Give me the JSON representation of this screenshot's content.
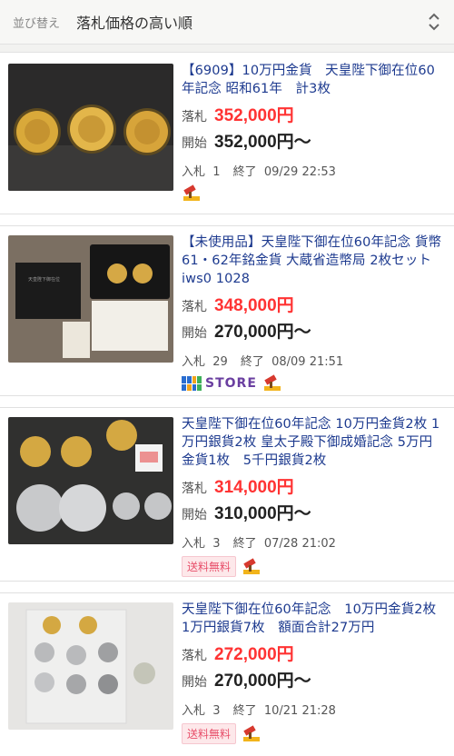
{
  "sortbar": {
    "label": "並び替え",
    "value": "落札価格の高い順"
  },
  "labels": {
    "sold": "落札",
    "start": "開始",
    "bids": "入札",
    "ends": "終了"
  },
  "items": [
    {
      "title": "【6909】10万円金貨　天皇陛下御在位60年記念 昭和61年　計3枚",
      "sold_price": "352,000円",
      "start_price": "352,000円～",
      "bids": "1",
      "end_time": "09/29 22:53",
      "badges": []
    },
    {
      "title": "【未使用品】天皇陛下御在位60年記念 貨幣 61・62年銘金貨 大蔵省造幣局 2枚セット iws0 1028",
      "sold_price": "348,000円",
      "start_price": "270,000円～",
      "bids": "29",
      "end_time": "08/09 21:51",
      "badges": [
        "STORE"
      ]
    },
    {
      "title": "天皇陛下御在位60年記念 10万円金貨2枚 1万円銀貨2枚 皇太子殿下御成婚記念 5万円金貨1枚　5千円銀貨2枚",
      "sold_price": "314,000円",
      "start_price": "310,000円～",
      "bids": "3",
      "end_time": "07/28 21:02",
      "badges": [
        "送料無料"
      ]
    },
    {
      "title": "天皇陛下御在位60年記念　10万円金貨2枚 1万円銀貨7枚　額面合計27万円",
      "sold_price": "272,000円",
      "start_price": "270,000円～",
      "bids": "3",
      "end_time": "10/21 21:28",
      "badges": [
        "送料無料"
      ]
    }
  ],
  "colors": {
    "link": "#1d3a8f",
    "sold_price": "#ff3333",
    "free_shipping_bg": "#fde8ea"
  },
  "icons": [
    "sort-toggle-icon",
    "gavel-hammer-icon",
    "store-logo-icon"
  ]
}
